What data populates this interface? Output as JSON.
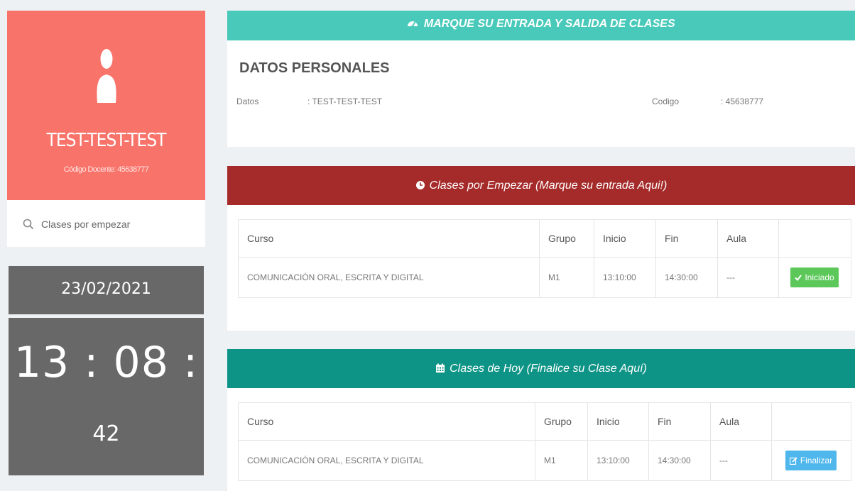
{
  "profile": {
    "name": "TEST-TEST-TEST",
    "code_label": "Código Docente: 45638777",
    "icon": "user-icon"
  },
  "sidebar": {
    "search_label": "Clases por empezar",
    "date": "23/02/2021",
    "clock": {
      "hours_minutes": "13 : 08 :",
      "seconds": "42"
    }
  },
  "header": {
    "title": "MARQUE SU ENTRADA Y SALIDA DE CLASES",
    "icon": "tachometer-icon"
  },
  "personal": {
    "title": "DATOS PERSONALES",
    "datos_label": "Datos",
    "datos_value": ": TEST-TEST-TEST",
    "codigo_label": "Codigo",
    "codigo_value": ": 45638777"
  },
  "panel_start": {
    "title": "Clases por Empezar (Marque su entrada Aqui!)",
    "icon": "clock-icon",
    "color": "#a52a2a",
    "columns": [
      "Curso",
      "Grupo",
      "Inicio",
      "Fin",
      "Aula"
    ],
    "row": {
      "curso": "COMUNICACIÓN ORAL, ESCRITA Y DIGITAL",
      "grupo": "M1",
      "inicio": "13:10:00",
      "fin": "14:30:00",
      "aula": "---",
      "action": "Iniciado"
    }
  },
  "panel_today": {
    "title": "Clases de Hoy (Finalice su Clase Aquí)",
    "icon": "calendar-icon",
    "color": "#0e9486",
    "columns": [
      "Curso",
      "Grupo",
      "Inicio",
      "Fin",
      "Aula"
    ],
    "row": {
      "curso": "COMUNICACIÓN ORAL, ESCRITA Y DIGITAL",
      "grupo": "M1",
      "inicio": "13:10:00",
      "fin": "14:30:00",
      "aula": "---",
      "action": "Finalizar"
    }
  },
  "colors": {
    "profile_bg": "#f8736a",
    "banner_bg": "#48c9b9",
    "clock_bg": "#686868",
    "success": "#5cc85a",
    "info": "#4fb7ec"
  }
}
